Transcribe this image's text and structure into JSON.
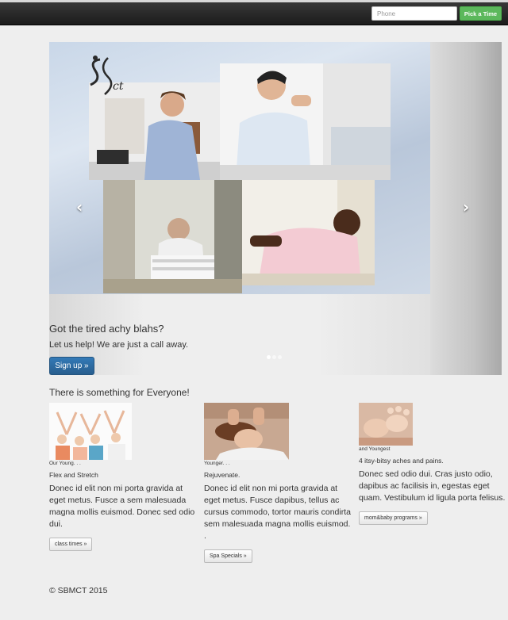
{
  "navbar": {
    "phone_placeholder": "Phone",
    "pick_time_label": "Pick a Time"
  },
  "carousel": {
    "logo_text": "SBMCT",
    "prev_icon": "chevron-left-icon",
    "next_icon": "chevron-right-icon",
    "caption_title": "Got the tired achy blahs?",
    "caption_text": "Let us help! We are just a call away.",
    "signup_label": "Sign up »",
    "active_slide": 0,
    "slide_count": 3
  },
  "section": {
    "title": "There is something for Everyone!"
  },
  "columns": [
    {
      "caption": "Our Young. . .",
      "heading": "Flex and Stretch",
      "text": "Donec id elit non mi porta gravida at eget metus. Fusce a sem malesuada magna mollis euismod. Donec sed odio dui.",
      "button": "class times »"
    },
    {
      "caption": "Younger. . .",
      "heading": "Rejuvenate.",
      "text": "Donec id elit non mi porta gravida at eget metus. Fusce dapibus, tellus ac cursus commodo, tortor mauris condirta sem malesuada magna mollis euismod. .",
      "button": "Spa Specials »"
    },
    {
      "caption": "and Youngest",
      "heading": "4 itsy-bitsy aches and pains.",
      "text": "Donec sed odio dui. Cras justo odio, dapibus ac facilisis in, egestas eget quam. Vestibulum id ligula porta felisus.",
      "button": "mom&baby programs »"
    }
  ],
  "footer": {
    "copyright": "© SBMCT 2015"
  },
  "colors": {
    "navbar": "#1c1c1c",
    "pick_button": "#5cb85c",
    "signup_button": "#337ab7",
    "page_bg": "#eeeeee"
  }
}
